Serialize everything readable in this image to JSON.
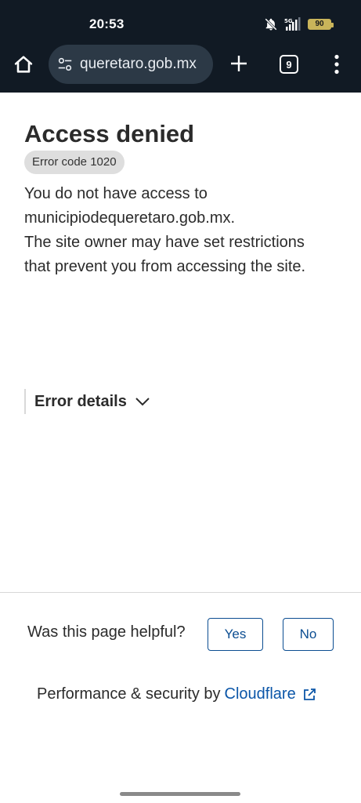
{
  "status_bar": {
    "time": "20:53",
    "battery_level": "90",
    "network_label": "5G",
    "icons": [
      "bell-off-icon",
      "signal-5g-icon",
      "battery-icon"
    ]
  },
  "toolbar": {
    "url": "queretaro.gob.mx",
    "tab_count": "9",
    "icons": [
      "home-icon",
      "tune-icon",
      "plus-icon",
      "tab-switcher-icon",
      "more-vert-icon"
    ]
  },
  "content": {
    "title": "Access denied",
    "error_code": "Error code 1020",
    "message_lines": [
      "You do not have access to",
      "municipiodequeretaro.gob.mx.",
      "The site owner may have set restrictions",
      "that prevent you from accessing the site."
    ],
    "error_details_label": "Error details"
  },
  "feedback": {
    "question": "Was this page helpful?",
    "yes_label": "Yes",
    "no_label": "No"
  },
  "footer": {
    "text": "Performance & security by",
    "link_text": "Cloudflare"
  },
  "colors": {
    "toolbar_bg": "#111a24",
    "urlbar_bg": "#2c3946",
    "link_blue": "#0b56a8",
    "button_border": "#0b4d91",
    "battery": "#c9b45a"
  }
}
